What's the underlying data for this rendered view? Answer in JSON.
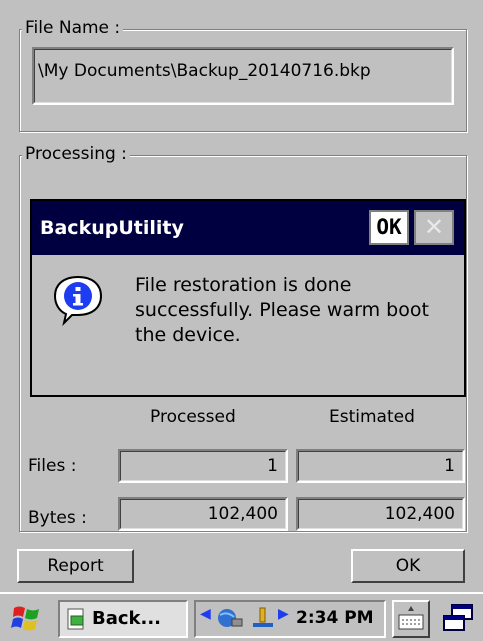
{
  "file_group": {
    "legend": "File Name :",
    "path": "\\My Documents\\Backup_20140716.bkp"
  },
  "processing_group": {
    "legend": "Processing :"
  },
  "table": {
    "col_processed": "Processed",
    "col_estimated": "Estimated",
    "rows": [
      {
        "label": "Files :",
        "processed": "1",
        "estimated": "1"
      },
      {
        "label": "Bytes :",
        "processed": "102,400",
        "estimated": "102,400"
      }
    ]
  },
  "buttons": {
    "report": "Report",
    "ok": "OK"
  },
  "dialog": {
    "title": "BackupUtility",
    "ok_label": "OK",
    "close_glyph": "✕",
    "icon": "info-icon",
    "message": "File restoration is done successfully. Please warm boot the device."
  },
  "taskbar": {
    "start_icon": "windows-flag-icon",
    "app_label": "Back...",
    "time": "2:34 PM",
    "keyboard_icon": "keyboard-icon",
    "switch_icon": "desktop-switch-icon"
  },
  "colors": {
    "title_bar": "#000040",
    "face": "#c0c0c0",
    "info_blue": "#1e3cf0"
  }
}
